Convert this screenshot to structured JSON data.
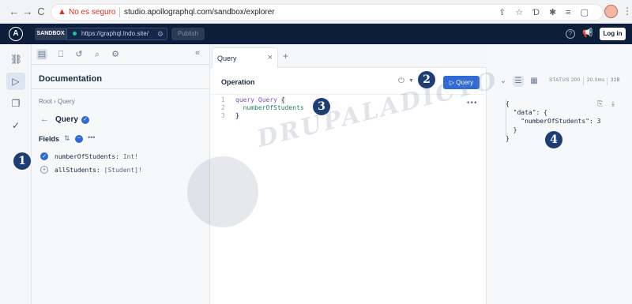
{
  "browser": {
    "back_icon": "arrow-left-icon",
    "forward_icon": "arrow-right-icon",
    "reload_icon": "reload-icon",
    "security_label": "No es seguro",
    "url": "studio.apollographql.com/sandbox/explorer"
  },
  "topbar": {
    "sandbox_label": "SANDBOX",
    "endpoint": "https://graphql.lndo.site/",
    "publish_label": "Publish",
    "login_label": "Log in"
  },
  "docs": {
    "title": "Documentation",
    "breadcrumb": "Root › Query",
    "type_name": "Query",
    "fields_label": "Fields",
    "fields": [
      {
        "name": "numberOfStudents",
        "type": "Int!",
        "selected": true
      },
      {
        "name": "allStudents",
        "type": "[Student]!",
        "selected": false
      }
    ]
  },
  "editor": {
    "tab_label": "Query",
    "operation_label": "Operation",
    "run_label": "Query",
    "code_lines": [
      {
        "num": "1",
        "kw": "query Query ",
        "field": "",
        "brace": "{"
      },
      {
        "num": "2",
        "kw": "",
        "field": "  numberOfStudents",
        "brace": ""
      },
      {
        "num": "3",
        "kw": "",
        "field": "",
        "brace": "}"
      }
    ]
  },
  "response": {
    "status_label": "STATUS",
    "status_code": "200",
    "time": "20.0ms",
    "size": "32B",
    "json_lines": [
      "{",
      "  \"data\": {",
      "    \"numberOfStudents\": 3",
      "  }",
      "}"
    ]
  },
  "callouts": [
    "1",
    "2",
    "3",
    "4"
  ],
  "watermark": "DRUPALADICTO",
  "colors": {
    "accent": "#2e6bd8",
    "appbar": "#0d1e3a",
    "callout": "#1d3d73",
    "insecure": "#d93025"
  }
}
